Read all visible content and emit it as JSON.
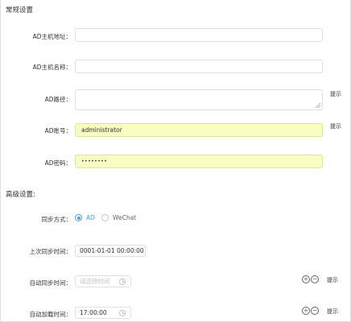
{
  "general": {
    "title": "常规设置",
    "host_label": "AD主机地址：",
    "host_value": "",
    "name_label": "AD主机名称：",
    "name_value": "",
    "path_label": "AD路径：",
    "path_value": "",
    "account_label": "AD账号：",
    "account_value": "administrator",
    "password_label": "AD密码：",
    "password_value": "••••••••",
    "hint": "提示"
  },
  "advanced": {
    "title": "高级设置:",
    "sync_mode_label": "同步方式：",
    "sync_options": [
      "AD",
      "WeChat"
    ],
    "sync_selected": "AD",
    "last_sync_label": "上次同步时间：",
    "last_sync_value": "0001-01-01 00:00:00",
    "auto_sync_label": "自动同步时间：",
    "auto_sync_placeholder": "请选择时间",
    "auto_load_label": "自动加载时间：",
    "auto_load_value": "17:00:00",
    "plus_icon": "+",
    "minus_icon": "−",
    "hint": "提示"
  }
}
